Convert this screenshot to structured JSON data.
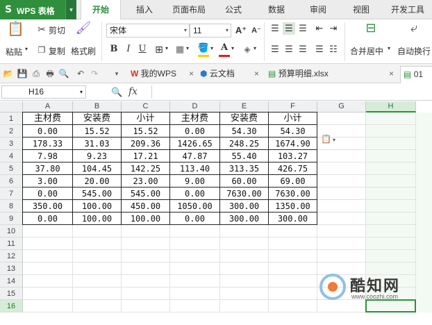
{
  "app": {
    "logo": "S",
    "title": "WPS 表格",
    "menu_drop": "▾"
  },
  "menu": {
    "tabs": [
      "开始",
      "插入",
      "页面布局",
      "公式",
      "数据",
      "审阅",
      "视图",
      "开发工具"
    ],
    "active": 0
  },
  "ribbon": {
    "paste": "粘贴",
    "cut": "剪切",
    "copy": "复制",
    "format_painter": "格式刷",
    "font_name": "宋体",
    "font_size": "11",
    "increase_font": "A⁺",
    "decrease_font": "A⁻",
    "bold": "B",
    "italic": "I",
    "underline": "U",
    "merge_center": "合并居中",
    "wrap_text": "自动换行",
    "dropdown_arrow": "▾",
    "colors": {
      "fill": "#f5d000",
      "font": "#e02020",
      "accent": "#2f8f3c"
    }
  },
  "doc_tabs": [
    {
      "label": "我的WPS",
      "icon": "wps-icon"
    },
    {
      "label": "云文档",
      "icon": "cloud-icon"
    },
    {
      "label": "预算明细.xlsx",
      "icon": "sheet-icon"
    },
    {
      "label": "01",
      "icon": "sheet-icon"
    }
  ],
  "close_glyph": "×",
  "formula_bar": {
    "name_box": "H16",
    "fx": "fx",
    "value": ""
  },
  "grid": {
    "columns": [
      "A",
      "B",
      "C",
      "D",
      "E",
      "F",
      "G",
      "H"
    ],
    "rows": [
      "1",
      "2",
      "3",
      "4",
      "5",
      "6",
      "7",
      "8",
      "9",
      "10",
      "11",
      "12",
      "13",
      "14",
      "15",
      "16"
    ],
    "selected_column": "H",
    "selected_row": "16",
    "table": [
      [
        "主材费",
        "安装费",
        "小计",
        "主材费",
        "安装费",
        "小计"
      ],
      [
        "0.00",
        "15.52",
        "15.52",
        "0.00",
        "54.30",
        "54.30"
      ],
      [
        "178.33",
        "31.03",
        "209.36",
        "1426.65",
        "248.25",
        "1674.90"
      ],
      [
        "7.98",
        "9.23",
        "17.21",
        "47.87",
        "55.40",
        "103.27"
      ],
      [
        "37.80",
        "104.45",
        "142.25",
        "113.40",
        "313.35",
        "426.75"
      ],
      [
        "3.00",
        "20.00",
        "23.00",
        "9.00",
        "60.00",
        "69.00"
      ],
      [
        "0.00",
        "545.00",
        "545.00",
        "0.00",
        "7630.00",
        "7630.00"
      ],
      [
        "350.00",
        "100.00",
        "450.00",
        "1050.00",
        "300.00",
        "1350.00"
      ],
      [
        "0.00",
        "100.00",
        "100.00",
        "0.00",
        "300.00",
        "300.00"
      ]
    ]
  },
  "watermark": {
    "name": "酷知网",
    "url": "www.coozhi.com"
  }
}
